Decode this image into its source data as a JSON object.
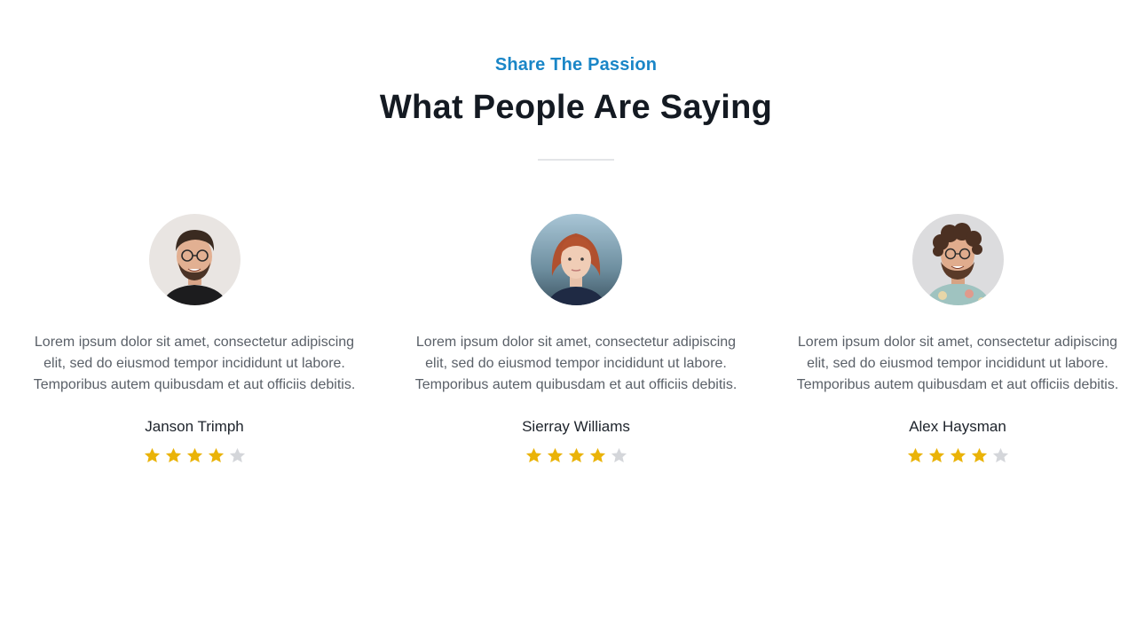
{
  "section": {
    "eyebrow": "Share The Passion",
    "heading": "What People Are Saying"
  },
  "colors": {
    "accent": "#1a86c7",
    "heading": "#141a22",
    "star_filled": "#eab308",
    "star_empty": "#d4d6da"
  },
  "testimonials": [
    {
      "quote_lines": [
        "Lorem ipsum dolor sit amet, consectetur adipiscing",
        "elit, sed do eiusmod tempor incididunt ut labore.",
        "Temporibus autem quibusdam et aut officiis debitis."
      ],
      "name": "Janson Trimph",
      "rating": 4,
      "rating_max": 5,
      "avatar_icon": "man-with-glasses-avatar"
    },
    {
      "quote_lines": [
        "Lorem ipsum dolor sit amet, consectetur adipiscing",
        "elit, sed do eiusmod tempor incididunt ut labore.",
        "Temporibus autem quibusdam et aut officiis debitis."
      ],
      "name": "Sierray Williams",
      "rating": 4,
      "rating_max": 5,
      "avatar_icon": "woman-red-hair-avatar"
    },
    {
      "quote_lines": [
        "Lorem ipsum dolor sit amet, consectetur adipiscing",
        "elit, sed do eiusmod tempor incididunt ut labore.",
        "Temporibus autem quibusdam et aut officiis debitis."
      ],
      "name": "Alex Haysman",
      "rating": 4,
      "rating_max": 5,
      "avatar_icon": "man-curly-hair-avatar"
    }
  ]
}
